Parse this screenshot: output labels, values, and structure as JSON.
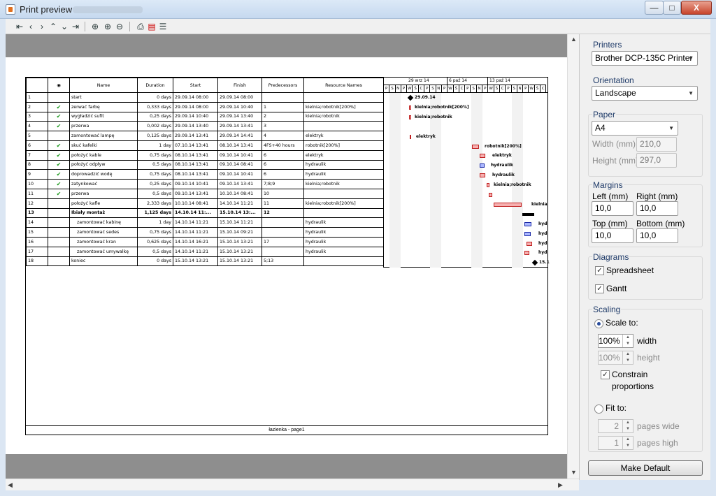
{
  "window": {
    "title": "Print preview",
    "minimize": "—",
    "maximize": "□",
    "close": "X"
  },
  "page": {
    "footer": "łazienka  -  page1"
  },
  "table": {
    "headers": [
      "",
      "",
      "Name",
      "Duration",
      "Start",
      "Finish",
      "Predecessors",
      "Resource Names"
    ],
    "rows": [
      {
        "id": "1",
        "check": "",
        "name": "start",
        "duration": "0 days",
        "start": "29.09.14 08:00",
        "finish": "29.09.14 08:00",
        "pred": "",
        "res": ""
      },
      {
        "id": "2",
        "check": "✔",
        "name": "zerwać farbę",
        "duration": "0,333 days",
        "start": "29.09.14 08:00",
        "finish": "29.09.14 10:40",
        "pred": "1",
        "res": "kielnia;robotnik[200%]"
      },
      {
        "id": "3",
        "check": "✔",
        "name": "wygładzić sufit",
        "duration": "0,25 days",
        "start": "29.09.14 10:40",
        "finish": "29.09.14 13:40",
        "pred": "2",
        "res": "kielnia;robotnik"
      },
      {
        "id": "4",
        "check": "✔",
        "name": "przerwa",
        "duration": "0,002 days",
        "start": "29.09.14 13:40",
        "finish": "29.09.14 13:41",
        "pred": "3",
        "res": ""
      },
      {
        "id": "5",
        "check": "",
        "name": "zamontować lampę",
        "duration": "0,125 days",
        "start": "29.09.14 13:41",
        "finish": "29.09.14 14:41",
        "pred": "4",
        "res": "elektryk"
      },
      {
        "id": "6",
        "check": "✔",
        "name": "skuć kafelki",
        "duration": "1 day",
        "start": "07.10.14 13:41",
        "finish": "08.10.14 13:41",
        "pred": "4FS+40 hours",
        "res": "robotnik[200%]"
      },
      {
        "id": "7",
        "check": "✔",
        "name": "położyć kable",
        "duration": "0,75 days",
        "start": "08.10.14 13:41",
        "finish": "09.10.14 10:41",
        "pred": "6",
        "res": "elektryk"
      },
      {
        "id": "8",
        "check": "✔",
        "name": "położyć odpływ",
        "duration": "0,5 days",
        "start": "08.10.14 13:41",
        "finish": "09.10.14 08:41",
        "pred": "6",
        "res": "hydraulik"
      },
      {
        "id": "9",
        "check": "✔",
        "name": "doprowadzić wodę",
        "duration": "0,75 days",
        "start": "08.10.14 13:41",
        "finish": "09.10.14 10:41",
        "pred": "6",
        "res": "hydraulik"
      },
      {
        "id": "10",
        "check": "✔",
        "name": "zatynkować",
        "duration": "0,25 days",
        "start": "09.10.14 10:41",
        "finish": "09.10.14 13:41",
        "pred": "7;8;9",
        "res": "kielnia;robotnik"
      },
      {
        "id": "11",
        "check": "✔",
        "name": "przerwa",
        "duration": "0,5 days",
        "start": "09.10.14 13:41",
        "finish": "10.10.14 08:41",
        "pred": "10",
        "res": ""
      },
      {
        "id": "12",
        "check": "",
        "name": "położyć kafle",
        "duration": "2,333 days",
        "start": "10.10.14 08:41",
        "finish": "14.10.14 11:21",
        "pred": "11",
        "res": "kielnia;robotnik[200%]"
      },
      {
        "id": "13",
        "check": "",
        "name": "Ibiały montaż",
        "duration": "1,125 days",
        "start": "14.10.14 11:...",
        "finish": "15.10.14 13:...",
        "pred": "12",
        "res": "",
        "bold": true
      },
      {
        "id": "14",
        "check": "",
        "name": "zamontować kabinę",
        "duration": "1 day",
        "start": "14.10.14 11:21",
        "finish": "15.10.14 11:21",
        "pred": "",
        "res": "hydraulik",
        "indent": true
      },
      {
        "id": "15",
        "check": "",
        "name": "zamontować sedes",
        "duration": "0,75 days",
        "start": "14.10.14 11:21",
        "finish": "15.10.14 09:21",
        "pred": "",
        "res": "hydraulik",
        "indent": true
      },
      {
        "id": "16",
        "check": "",
        "name": "zamontować kran",
        "duration": "0,625 days",
        "start": "14.10.14 16:21",
        "finish": "15.10.14 13:21",
        "pred": "17",
        "res": "hydraulik",
        "indent": true
      },
      {
        "id": "17",
        "check": "",
        "name": "zamontować umywalkę",
        "duration": "0,5 days",
        "start": "14.10.14 11:21",
        "finish": "15.10.14 13:21",
        "pred": "",
        "res": "hydraulik",
        "indent": true
      },
      {
        "id": "18",
        "check": "",
        "name": "koniec",
        "duration": "0 days",
        "start": "15.10.14 13:21",
        "finish": "15.10.14 13:21",
        "pred": "5;13",
        "res": ""
      }
    ]
  },
  "gantt": {
    "weeks": [
      "29 wrz 14",
      "6 paź 14",
      "13 paź 14"
    ],
    "days": [
      "P",
      "S",
      "N",
      "P",
      "W",
      "Ś",
      "C",
      "P",
      "S",
      "N",
      "P",
      "W",
      "Ś",
      "C",
      "P",
      "S",
      "N",
      "P",
      "W",
      "Ś",
      "C",
      "P",
      "S",
      "N",
      "P",
      "W",
      "Ś",
      "C"
    ],
    "labels": [
      "29.09.14",
      "kielnia;robotnik[200%]",
      "kielnia;robotnik",
      "elektryk",
      "robotnik[200%]",
      "elektryk",
      "hydraulik",
      "hydraulik",
      "kielnia;robotnik",
      "kielnia",
      "hyd",
      "hyd",
      "hyd",
      "hyd",
      "15.1"
    ]
  },
  "panel": {
    "printers_title": "Printers",
    "printer_value": "Brother DCP-135C Printer",
    "orientation_title": "Orientation",
    "orientation_value": "Landscape",
    "paper_title": "Paper",
    "paper_value": "A4",
    "width_label": "Width (mm):",
    "width_value": "210,0",
    "height_label": "Height (mm):",
    "height_value": "297,0",
    "margins_title": "Margins",
    "left_label": "Left (mm)",
    "right_label": "Right (mm)",
    "left_value": "10,0",
    "right_value": "10,0",
    "top_label": "Top (mm)",
    "bottom_label": "Bottom (mm)",
    "top_value": "10,0",
    "bottom_value": "10,0",
    "diagrams_title": "Diagrams",
    "spreadsheet_label": "Spreadsheet",
    "gantt_label": "Gantt",
    "scaling_title": "Scaling",
    "scale_to_label": "Scale to:",
    "width_pct": "100%",
    "width_word": "width",
    "height_pct": "100%",
    "height_word": "height",
    "constrain_label": "Constrain",
    "proportions_label": "proportions",
    "fit_to_label": "Fit to:",
    "pages_wide_value": "2",
    "pages_wide_label": "pages wide",
    "pages_high_value": "1",
    "pages_high_label": "pages high",
    "make_default": "Make Default"
  }
}
